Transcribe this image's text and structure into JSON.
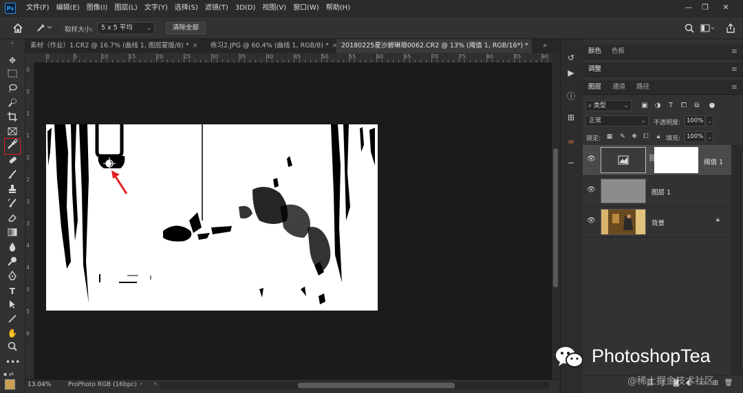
{
  "menubar": {
    "app_logo": "Ps",
    "items": [
      "文件(F)",
      "编辑(E)",
      "图像(I)",
      "图层(L)",
      "文字(Y)",
      "选择(S)",
      "滤镜(T)",
      "3D(D)",
      "视图(V)",
      "窗口(W)",
      "帮助(H)"
    ],
    "window_controls": [
      "—",
      "❐",
      "✕"
    ]
  },
  "options_bar": {
    "sample_size_label": "取样大小:",
    "sample_size_value": "5 x 5 平均",
    "clear_all_label": "清除全部"
  },
  "tabs": [
    {
      "label": "素材（作业）1.CR2 @ 16.7% (曲线 1, 图层蒙版/8) *",
      "active": false
    },
    {
      "label": "练习2.JPG @ 60.4% (曲线 1, RGB/8) *",
      "active": false
    },
    {
      "label": "20180225星沙碧琳琅0062.CR2 @ 13% (阈值 1, RGB/16*) *",
      "active": true
    }
  ],
  "ruler_top": [
    "0",
    "5",
    "10",
    "15",
    "20",
    "25",
    "30",
    "35",
    "40",
    "45",
    "50",
    "55",
    "60",
    "65",
    "70",
    "75",
    "80",
    "85",
    "90"
  ],
  "ruler_left": [
    "0",
    "5",
    "1",
    "1",
    "2",
    "2",
    "3",
    "3",
    "4",
    "4",
    "5",
    "5",
    "6"
  ],
  "status": {
    "zoom": "13.04%",
    "profile": "ProPhoto RGB (16bpc)"
  },
  "panels": {
    "color_tabs": [
      "颜色",
      "色板"
    ],
    "adjust_tabs": [
      "调整"
    ],
    "layer_tabs": [
      "图层",
      "通道",
      "路径"
    ],
    "kind_filter": "类型",
    "blend_mode": "正常",
    "opacity_label": "不透明度:",
    "opacity_value": "100%",
    "lock_label": "锁定:",
    "fill_label": "填充:",
    "fill_value": "100%"
  },
  "layers": [
    {
      "name": "阈值 1",
      "selected": true
    },
    {
      "name": "图层 1",
      "selected": false
    },
    {
      "name": "背景",
      "selected": false,
      "locked": true
    }
  ],
  "watermark": {
    "brand": "PhotoshopTea",
    "community": "@稀土掘金技术社区"
  },
  "colors": {
    "accent_red": "#e02020",
    "canvas": "#ffffff",
    "workspace": "#1b1b1b"
  }
}
